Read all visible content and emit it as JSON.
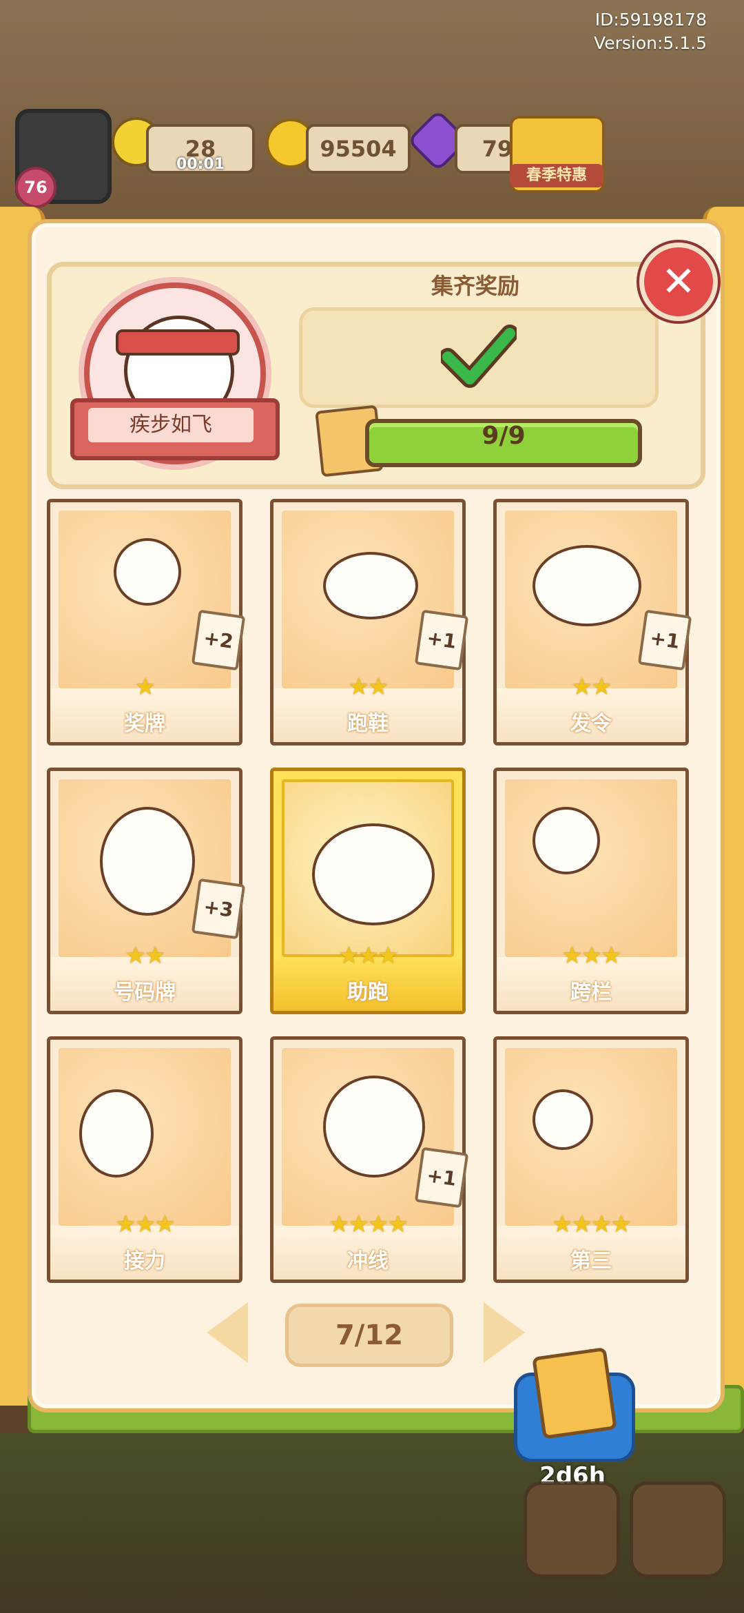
{
  "info": {
    "id": "ID:59198178",
    "version": "Version:5.1.5"
  },
  "hud": {
    "level": "76",
    "energy": "28",
    "energy_timer": "00:01",
    "coins": "95504",
    "gems": "79",
    "promo_label": "春季特惠"
  },
  "album": {
    "set_name": "疾步如飞",
    "reward_title": "集齐奖励",
    "progress": "9/9",
    "progress_fraction": 1.0,
    "page": "7/12"
  },
  "cards": [
    {
      "name": "奖牌",
      "stars": "★",
      "extra": "+2",
      "gold": false
    },
    {
      "name": "跑鞋",
      "stars": "★★",
      "extra": "+1",
      "gold": false
    },
    {
      "name": "发令",
      "stars": "★★",
      "extra": "+1",
      "gold": false
    },
    {
      "name": "号码牌",
      "stars": "★★",
      "extra": "+3",
      "gold": false
    },
    {
      "name": "助跑",
      "stars": "★★★",
      "extra": "",
      "gold": true
    },
    {
      "name": "跨栏",
      "stars": "★★★",
      "extra": "",
      "gold": false
    },
    {
      "name": "接力",
      "stars": "★★★",
      "extra": "",
      "gold": false
    },
    {
      "name": "冲线",
      "stars": "★★★★",
      "extra": "+1",
      "gold": false
    },
    {
      "name": "第三",
      "stars": "★★★★",
      "extra": "",
      "gold": false
    }
  ],
  "pack": {
    "timer": "2d6h"
  },
  "icons": [
    "close-icon",
    "check-icon",
    "chevron-left-icon",
    "chevron-right-icon",
    "card-pack-icon",
    "coin-icon",
    "gem-icon",
    "energy-icon"
  ],
  "colors": {
    "accent": "#f3c34f",
    "close": "#e24a4a",
    "progress": "#8ed13a",
    "gold_card": "#ffe25a"
  }
}
